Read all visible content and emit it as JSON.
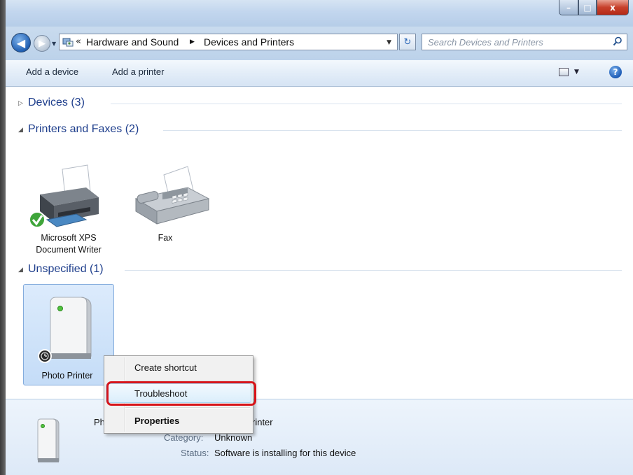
{
  "window": {
    "title_buttons": {
      "minimize": "–",
      "maximize": "□",
      "close": "x"
    }
  },
  "nav": {
    "back_icon": "back-arrow-icon",
    "forward_icon": "forward-arrow-icon"
  },
  "address": {
    "overflow": "«",
    "crumbs": [
      "Hardware and Sound",
      "Devices and Printers"
    ]
  },
  "search": {
    "placeholder": "Search Devices and Printers"
  },
  "toolbar": {
    "add_device": "Add a device",
    "add_printer": "Add a printer",
    "help": "?"
  },
  "groups": {
    "devices": {
      "title": "Devices (3)"
    },
    "printers": {
      "title": "Printers and Faxes (2)",
      "items": [
        {
          "label_line1": "Microsoft XPS",
          "label_line2": "Document Writer",
          "icon": "printer-icon",
          "default": true
        },
        {
          "label_line1": "Fax",
          "icon": "fax-icon"
        }
      ]
    },
    "unspecified": {
      "title": "Unspecified (1)",
      "items": [
        {
          "label": "Photo Printer",
          "icon": "storage-device-icon",
          "selected": true
        }
      ]
    }
  },
  "context_menu": {
    "items": [
      {
        "label": "Create shortcut"
      },
      {
        "label": "Troubleshoot",
        "highlighted": true
      },
      {
        "label": "Properties",
        "bold": true
      }
    ]
  },
  "details": {
    "name_visible_prefix": "Ph",
    "name_visible_suffix": "rinter",
    "category_key": "Category:",
    "category_value": "Unknown",
    "status_key": "Status:",
    "status_value": "Software is installing for this device"
  },
  "colors": {
    "group_title": "#1e3e8c",
    "selection_fill": "#c4dcf7",
    "highlight_ring": "#d7141a"
  }
}
